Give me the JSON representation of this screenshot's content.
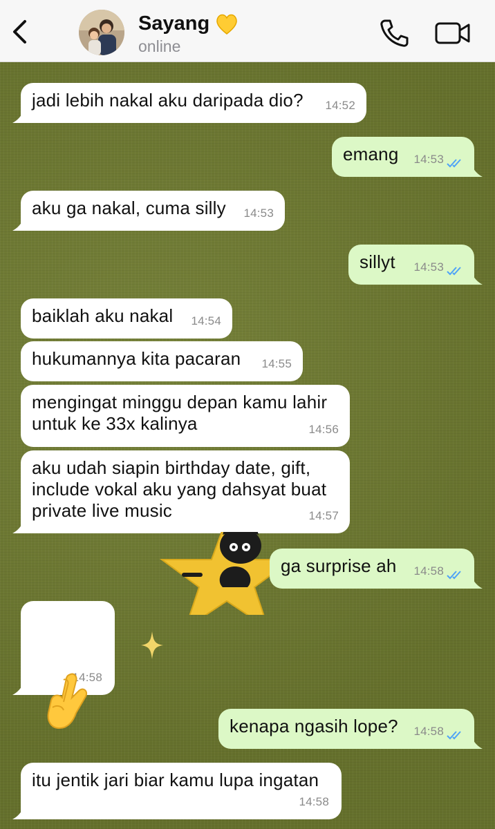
{
  "header": {
    "back_icon": "chevron-left-icon",
    "contact_name": "Sayang",
    "name_emoji": "yellow-heart-icon",
    "status": "online",
    "call_icon": "phone-icon",
    "video_icon": "video-camera-icon"
  },
  "colors": {
    "incoming_bubble": "#ffffff",
    "outgoing_bubble": "#dcf8c6",
    "read_ticks": "#4fa3f7",
    "wallpaper": "#6c7632"
  },
  "messages": [
    {
      "dir": "in",
      "text": "jadi lebih nakal aku daripada dio?",
      "time": "14:52"
    },
    {
      "dir": "out",
      "text": "emang",
      "time": "14:53",
      "read": true
    },
    {
      "dir": "in",
      "text": "aku ga nakal, cuma silly",
      "time": "14:53"
    },
    {
      "dir": "out",
      "text": "sillyt",
      "time": "14:53",
      "read": true
    },
    {
      "dir": "in",
      "text": "baiklah aku nakal",
      "time": "14:54"
    },
    {
      "dir": "in",
      "text": "hukumannya kita pacaran",
      "time": "14:55"
    },
    {
      "dir": "in",
      "text": "mengingat minggu depan kamu lahir untuk ke 33x kalinya",
      "time": "14:56"
    },
    {
      "dir": "in",
      "text": "aku udah siapin birthday date, gift, include vokal aku yang dahsyat buat private live music",
      "time": "14:57"
    },
    {
      "dir": "out",
      "text": "ga surprise ah",
      "time": "14:58",
      "read": true
    },
    {
      "dir": "in",
      "emoji": "crossed-fingers-heart-icon",
      "time": "14:58"
    },
    {
      "dir": "out",
      "text": "kenapa ngasih lope?",
      "time": "14:58",
      "read": true
    },
    {
      "dir": "in",
      "text": "itu jentik jari biar kamu lupa ingatan",
      "time": "14:58"
    }
  ],
  "sticker": "black-cat-star-sticker"
}
